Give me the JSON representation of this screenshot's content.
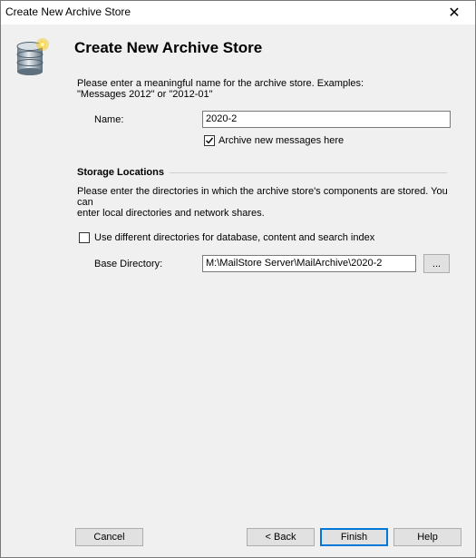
{
  "window": {
    "title": "Create New Archive Store",
    "close_glyph": "✕"
  },
  "header": {
    "title": "Create New Archive Store",
    "icon": "database-icon"
  },
  "intro": {
    "line1": "Please enter a meaningful name for the archive store. Examples:",
    "line2": "\"Messages 2012\" or \"2012-01\""
  },
  "name_field": {
    "label": "Name:",
    "value": "2020-2"
  },
  "archive_checkbox": {
    "label": "Archive new messages here",
    "checked": true
  },
  "storage": {
    "title": "Storage Locations",
    "desc_line1": "Please enter the directories in which the archive store's components are stored. You can",
    "desc_line2": "enter local directories and network shares.",
    "different_dirs_label": "Use different directories for database, content and search index",
    "different_dirs_checked": false,
    "base_dir_label": "Base Directory:",
    "base_dir_value": "M:\\MailStore Server\\MailArchive\\2020-2",
    "browse_label": "..."
  },
  "buttons": {
    "cancel": "Cancel",
    "back": "< Back",
    "finish": "Finish",
    "help": "Help"
  },
  "colors": {
    "window_bg": "#f0f0f0",
    "accent": "#0078d7",
    "icon_gold": "#f5c518"
  }
}
